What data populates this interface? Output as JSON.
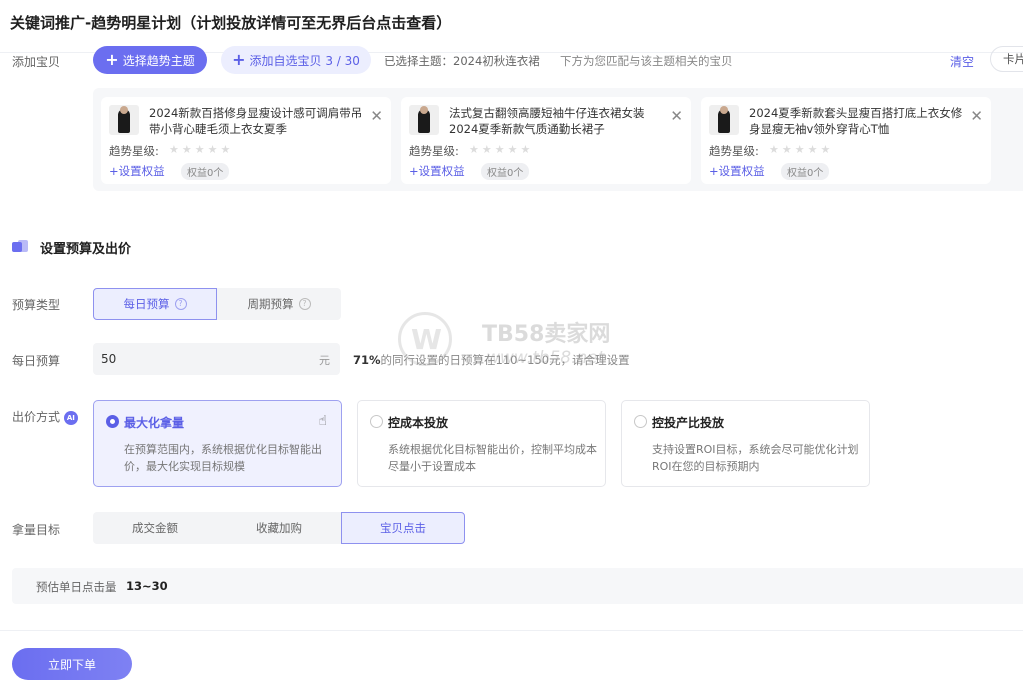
{
  "header": {
    "title": "关键词推广-趋势明星计划（计划投放详情可至无界后台点击查看）"
  },
  "add_product": {
    "label": "添加宝贝",
    "theme_button": "选择趋势主题",
    "custom_button": "添加自选宝贝 3 / 30",
    "selected_theme": "已选择主题：2024初秋连衣裙",
    "tip": "下方为您匹配与该主题相关的宝贝",
    "clear": "清空",
    "view_toggle": "卡片"
  },
  "products": [
    {
      "name": "2024新款百搭修身显瘦设计感可调肩带吊带小背心睫毛须上衣女夏季",
      "star_label": "趋势星级:",
      "set_benefit": "+设置权益",
      "benefit_count": "权益0个"
    },
    {
      "name": "法式复古翻领高腰短袖牛仔连衣裙女装2024夏季新款气质通勤长裙子",
      "star_label": "趋势星级:",
      "set_benefit": "+设置权益",
      "benefit_count": "权益0个"
    },
    {
      "name": "2024夏季新款套头显瘦百搭打底上衣女修身显瘦无袖v领外穿背心T恤",
      "star_label": "趋势星级:",
      "set_benefit": "+设置权益",
      "benefit_count": "权益0个"
    }
  ],
  "budget_section": {
    "title": "设置预算及出价"
  },
  "budget_type": {
    "label": "预算类型",
    "options": [
      "每日预算",
      "周期预算"
    ],
    "selected": "每日预算"
  },
  "daily_budget": {
    "label": "每日预算",
    "value": "50",
    "unit": "元",
    "tip_pct": "71%",
    "tip_text": "的同行设置的日预算在110~150元，请合理设置"
  },
  "bid_method": {
    "label": "出价方式",
    "ai_badge": "AI",
    "options": [
      {
        "title": "最大化拿量",
        "desc": "在预算范围内，系统根据优化目标智能出价，最大化实现目标规模"
      },
      {
        "title": "控成本投放",
        "desc": "系统根据优化目标智能出价，控制平均成本尽量小于设置成本"
      },
      {
        "title": "控投产比投放",
        "desc": "支持设置ROI目标，系统会尽可能优化计划ROI在您的目标预期内"
      }
    ],
    "selected_index": 0
  },
  "target": {
    "label": "拿量目标",
    "options": [
      "成交金额",
      "收藏加购",
      "宝贝点击"
    ],
    "selected": "宝贝点击"
  },
  "estimate": {
    "label": "预估单日点击量",
    "value": "13~30"
  },
  "submit": {
    "label": "立即下单"
  },
  "watermark": {
    "text": "TB58卖家网",
    "url": "www.tb58.net"
  },
  "colors": {
    "accent": "#6b6ef0",
    "accent_text": "#5b5fe6"
  }
}
